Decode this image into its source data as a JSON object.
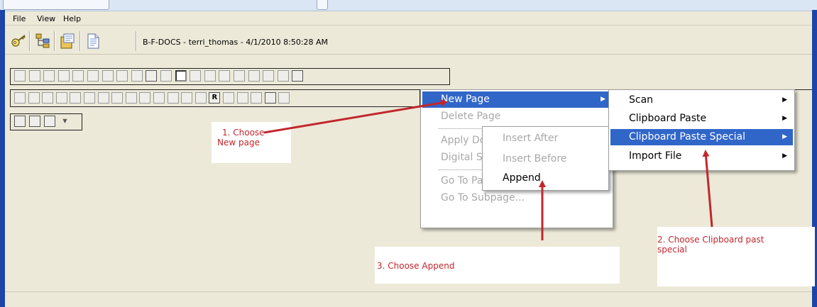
{
  "menubar": {
    "items": [
      "File",
      "View",
      "Help"
    ]
  },
  "header": {
    "doc_title": "B-F-DOCS - terri_thomas - 4/1/2010 8:50:28 AM",
    "icons": [
      "key-icon",
      "tree-icon",
      "documents-icon",
      "page-icon"
    ]
  },
  "toolbar1": {
    "icons": [
      "fit-page-icon",
      "fit-height-icon",
      "fit-width-icon",
      "rotate-left-icon",
      "rotate-right-icon",
      "zoom-in-icon",
      "zoom-out-icon",
      "page-icon",
      "text-icon",
      "binoculars-icon",
      "select-icon",
      "hand-icon",
      "view-icon",
      "print-icon",
      "info-icon",
      "first-page-icon",
      "last-page-icon",
      "copy-icon",
      "cube-icon",
      "clipboard-icon"
    ]
  },
  "toolbar2": {
    "icons": [
      "pointer-icon",
      "text-box-icon",
      "marker-icon",
      "pen-icon",
      "line-icon",
      "arrow-line-icon",
      "rectangle-icon",
      "rounded-rect-icon",
      "ellipse-icon",
      "polygon-icon",
      "freeform-icon",
      "highlighter-icon",
      "eraser-icon",
      "stamp-icon",
      "r-icon",
      "note-icon",
      "connector-icon",
      "image-icon",
      "paste-icon",
      "attach-icon"
    ],
    "r_label": "R"
  },
  "toolbar3": {
    "icons": [
      "layer-icon",
      "layer-icon",
      "layer-icon"
    ]
  },
  "menu_main": {
    "items": [
      {
        "label": "New Page",
        "state": "highlighted",
        "submenu": true
      },
      {
        "label": "Delete Page",
        "state": "disabled"
      },
      {
        "label": "Apply Document Template",
        "state": "disabled"
      },
      {
        "label": "Digital Signature",
        "state": "disabled"
      },
      {
        "label": "Go To Page...",
        "state": "disabled"
      },
      {
        "label": "Go To Subpage...",
        "state": "disabled"
      }
    ]
  },
  "menu_insert": {
    "items": [
      {
        "label": "Insert After",
        "state": "disabled"
      },
      {
        "label": "Insert Before",
        "state": "disabled"
      },
      {
        "label": "Append",
        "state": "enabled"
      }
    ]
  },
  "menu_new_page": {
    "items": [
      {
        "label": "Scan",
        "state": "enabled",
        "submenu": true
      },
      {
        "label": "Clipboard Paste",
        "state": "enabled",
        "submenu": true
      },
      {
        "label": "Clipboard Paste Special",
        "state": "highlighted",
        "submenu": true
      },
      {
        "label": "Import File",
        "state": "enabled",
        "submenu": true
      }
    ]
  },
  "annotations": {
    "step1": {
      "line1": "1.  Choose",
      "line2": "New page"
    },
    "step2": {
      "line1": "2.  Choose Clipboard past",
      "line2": "special"
    },
    "step3": {
      "text": "3.  Choose Append"
    },
    "color": "#c1272d"
  },
  "colors": {
    "highlight": "#3166c9",
    "title_bar": "#1e44a8",
    "chrome": "#ece9d8"
  }
}
